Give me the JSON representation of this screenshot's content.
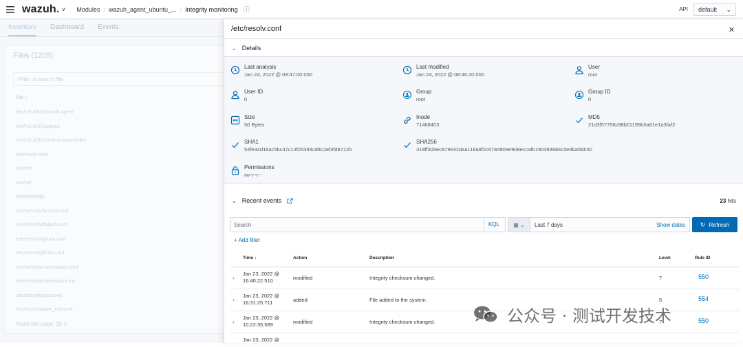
{
  "topbar": {
    "logo": "wazuh",
    "breadcrumbs": [
      "Modules",
      "wazuh_agent_ubuntu_...",
      "Integrity monitoring"
    ],
    "api_label": "API",
    "api_selected": "default"
  },
  "background": {
    "tabs": [
      "Inventory",
      "Dashboard",
      "Events"
    ],
    "files_title": "Files (1205)",
    "filter_placeholder": "Filter or search file",
    "column_header": "File ↑",
    "files": [
      "/etc/rc6.d/K01wazuh-agent",
      "/etc/rc5.d/S01procps",
      "/etc/rc5.d/S01selinux-autorelabel",
      "/etc/resolv.conf",
      "/etc/rmt",
      "/etc/rpc",
      "/etc/securetty",
      "/etc/security/access.conf",
      "/etc/security/faillock.conf",
      "/etc/security/group.conf",
      "/etc/security/limits.conf",
      "/etc/security/namespace.conf",
      "/etc/security/namespace.init",
      "/etc/security/opasswd",
      "/etc/security/pam_env.conf"
    ],
    "rows_per_page": "Rows per page: 15"
  },
  "flyout": {
    "title": "/etc/resolv.conf",
    "details_label": "Details",
    "details": [
      {
        "label": "Last analysis",
        "value": "Jan 24, 2022 @ 08:47:00.000",
        "icon": "clock-icon"
      },
      {
        "label": "Last modified",
        "value": "Jan 24, 2022 @ 08:46:20.000",
        "icon": "clock-icon"
      },
      {
        "label": "User",
        "value": "root",
        "icon": "user-icon"
      },
      {
        "label": "User ID",
        "value": "0",
        "icon": "user-icon"
      },
      {
        "label": "Group",
        "value": "root",
        "icon": "group-icon"
      },
      {
        "label": "Group ID",
        "value": "0",
        "icon": "group-icon"
      },
      {
        "label": "Size",
        "value": "50 Bytes",
        "icon": "size-icon"
      },
      {
        "label": "Inode",
        "value": "71468403",
        "icon": "link-icon"
      },
      {
        "label": "MD5",
        "value": "21d3f57756c88b01199b5a81e1a3faf2",
        "icon": "check-icon"
      },
      {
        "label": "SHA1",
        "value": "54fe34d16ac5bc47c13f25394cd8c2ef3fd8712b",
        "icon": "check-icon"
      },
      {
        "label": "SHA256",
        "value": "318ff3d4ec879632daa118a9f2c6784909e908eccafb190393884cde3ba5bb50",
        "icon": "check-icon"
      },
      {
        "label": "Permissions",
        "value": "rw-r--r--",
        "icon": "lock-icon"
      }
    ],
    "recent_events_label": "Recent events",
    "hits_count": "23",
    "hits_label": "hits",
    "search_placeholder": "Search",
    "kql": "KQL",
    "date_range": "Last 7 days",
    "show_dates": "Show dates",
    "refresh": "Refresh",
    "add_filter": "+ Add filter",
    "table": {
      "headers": [
        "Time ↓",
        "Action",
        "Description",
        "Level",
        "Rule ID"
      ],
      "rows": [
        {
          "time": "Jan 23, 2022 @ 16:40:22.510",
          "action": "modified",
          "description": "Integrity checksum changed.",
          "level": "7",
          "rule": "550"
        },
        {
          "time": "Jan 23, 2022 @ 16:31:25.711",
          "action": "added",
          "description": "File added to the system.",
          "level": "5",
          "rule": "554"
        },
        {
          "time": "Jan 23, 2022 @ 10:22:35.589",
          "action": "modified",
          "description": "Integrity checksum changed.",
          "level": "7",
          "rule": "550"
        },
        {
          "time": "Jan 23, 2022 @",
          "action": "",
          "description": "",
          "level": "",
          "rule": ""
        }
      ]
    }
  },
  "watermark": "公众号 · 测试开发技术"
}
